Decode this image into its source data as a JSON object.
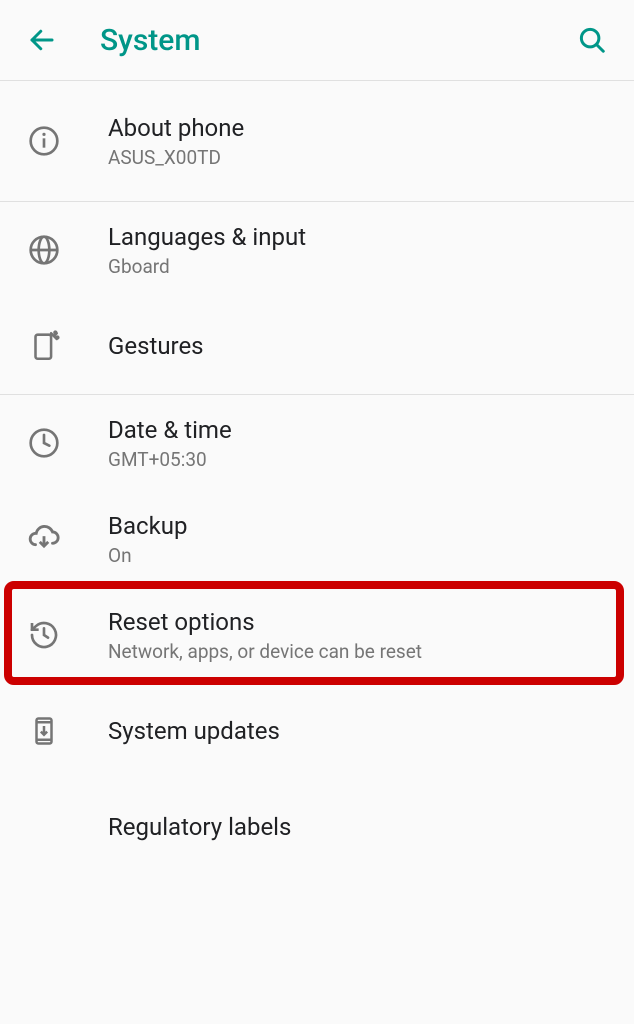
{
  "header": {
    "title": "System"
  },
  "items": [
    {
      "label": "About phone",
      "sublabel": "ASUS_X00TD",
      "icon": "info"
    },
    {
      "label": "Languages & input",
      "sublabel": "Gboard",
      "icon": "globe"
    },
    {
      "label": "Gestures",
      "sublabel": "",
      "icon": "gestures"
    },
    {
      "label": "Date & time",
      "sublabel": "GMT+05:30",
      "icon": "clock"
    },
    {
      "label": "Backup",
      "sublabel": "On",
      "icon": "cloud-download"
    },
    {
      "label": "Reset options",
      "sublabel": "Network, apps, or device can be reset",
      "icon": "restore"
    },
    {
      "label": "System updates",
      "sublabel": "",
      "icon": "system-update"
    },
    {
      "label": "Regulatory labels",
      "sublabel": "",
      "icon": ""
    }
  ],
  "highlighted_index": 5,
  "colors": {
    "accent": "#009688",
    "highlight": "#cc0000"
  }
}
